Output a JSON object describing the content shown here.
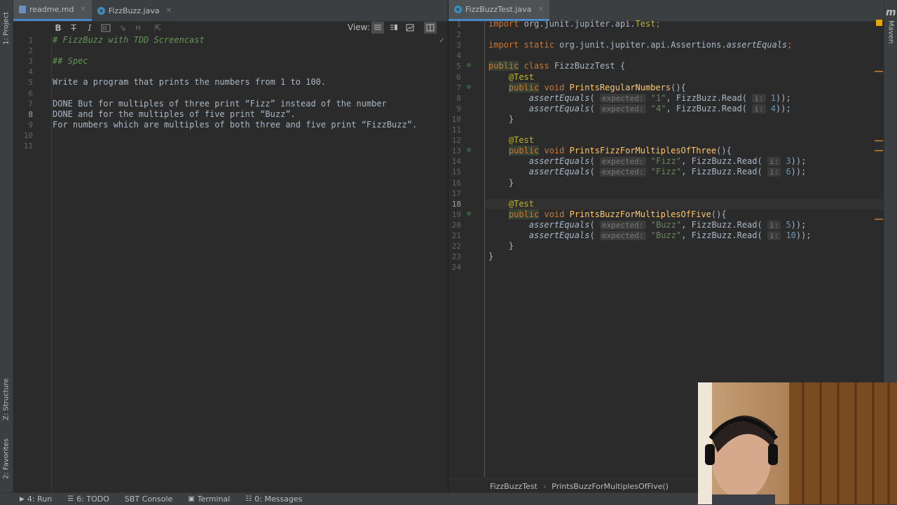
{
  "left_strip": {
    "project": "1: Project",
    "structure": "Z: Structure",
    "favorites": "2: Favorites"
  },
  "right_strip": {
    "maven": "Maven"
  },
  "left_tabs": [
    {
      "label": "readme.md",
      "active": true
    },
    {
      "label": "FizzBuzz.java",
      "active": false
    }
  ],
  "right_tabs": [
    {
      "label": "FizzBuzzTest.java",
      "active": true
    }
  ],
  "md_toolbar": {
    "bold": "B",
    "strike": "T",
    "italic": "I",
    "view_label": "View:"
  },
  "readme_lines": [
    "# FizzBuzz with TDD Screencast",
    "",
    "## Spec",
    "",
    "Write a program that prints the numbers from 1 to 100.",
    "",
    "DONE But for multiples of three print “Fizz” instead of the number",
    "DONE and for the multiples of five print “Buzz”.",
    "For numbers which are multiples of both three and five print “FizzBuzz”.",
    "",
    ""
  ],
  "java": {
    "import1": "import org.junit.jupiter.api.",
    "import1_cls": "Test",
    "import2": "import static org.junit.jupiter.api.Assertions.",
    "import2_fn": "assertEquals",
    "class_decl": "class FizzBuzzTest {",
    "public_kw": "public",
    "void_kw": "void",
    "test_ann": "@Test",
    "method1": "PrintsRegularNumbers",
    "method2": "PrintsFizzForMultiplesOfThree",
    "method3": "PrintsBuzzForMultiplesOfFive",
    "assert": "assertEquals",
    "hint_expected": "expected:",
    "hint_i": "i:",
    "call": "FizzBuzz.Read(",
    "asserts": [
      {
        "line": 8,
        "exp": "\"1\"",
        "arg": "1"
      },
      {
        "line": 9,
        "exp": "\"4\"",
        "arg": "4"
      },
      {
        "line": 14,
        "exp": "\"Fizz\"",
        "arg": "3"
      },
      {
        "line": 15,
        "exp": "\"Fizz\"",
        "arg": "6"
      },
      {
        "line": 20,
        "exp": "\"Buzz\"",
        "arg": "5"
      },
      {
        "line": 21,
        "exp": "\"Buzz\"",
        "arg": "10"
      }
    ]
  },
  "breadcrumb": {
    "cls": "FizzBuzzTest",
    "method": "PrintsBuzzForMultiplesOfFive()"
  },
  "bottom_bar": {
    "run": "4: Run",
    "todo": "6: TODO",
    "sbt": "SBT Console",
    "terminal": "Terminal",
    "messages": "0: Messages"
  },
  "colors": {
    "keyword": "#cc7832",
    "annotation": "#bbb529",
    "string": "#6a8759",
    "number": "#6897bb",
    "method": "#ffc66d"
  }
}
